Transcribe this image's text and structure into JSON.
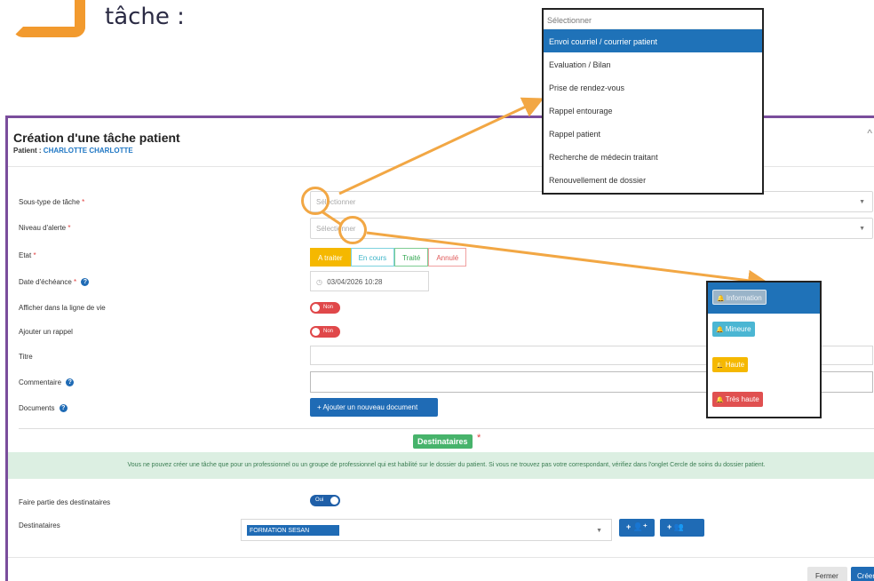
{
  "step": {
    "title": "tâche :"
  },
  "modal": {
    "title": "Création d'une tâche patient",
    "patient_label": "Patient :",
    "patient_name": "CHARLOTTE CHARLOTTE",
    "close_icon": "^"
  },
  "form": {
    "subtype_label": "Sous-type de tâche",
    "alert_label": "Niveau d'alerte",
    "state_label": "Etat",
    "due_label": "Date d'échéance",
    "timeline_label": "Afficher dans la ligne de vie",
    "reminder_label": "Ajouter un rappel",
    "title_label": "Titre",
    "comment_label": "Commentaire",
    "documents_label": "Documents",
    "required_mark": "*",
    "help_icon": "?",
    "select_placeholder": "Sélectionner",
    "states": [
      "A traiter",
      "En cours",
      "Traité",
      "Annulé"
    ],
    "due_date": "03/04/2026 10:28",
    "toggle_off": "Non",
    "toggle_on": "Oui",
    "add_document": "+ Ajouter un nouveau document"
  },
  "recipients": {
    "section_label": "Destinataires",
    "info_text": "Vous ne pouvez créer une tâche que pour un professionnel ou un groupe de professionnel qui est habilité sur le dossier du patient. Si vous ne trouvez pas votre correspondant, vérifiez dans l'onglet Cercle de soins du dossier patient.",
    "self_label": "Faire partie des destinataires",
    "list_label": "Destinataires",
    "selected": "FORMATION SESAN",
    "add_person": "+ 👤⁺",
    "add_group": "+ 👥"
  },
  "footer": {
    "close": "Fermer",
    "create": "Créer"
  },
  "subtype_dropdown": {
    "placeholder": "Sélectionner",
    "options": [
      "Envoi courriel / courrier patient",
      "Evaluation / Bilan",
      "Prise de rendez-vous",
      "Rappel entourage",
      "Rappel patient",
      "Recherche de médecin traitant",
      "Renouvellement de dossier"
    ],
    "selected_index": 0
  },
  "alert_dropdown": {
    "options": [
      "Information",
      "Mineure",
      "Haute",
      "Très haute"
    ],
    "selected_index": 0
  },
  "colors": {
    "accent_orange": "#f29a2e",
    "primary_blue": "#1f6bb5",
    "modal_border": "#7a4d9c",
    "success_green": "#47b36b"
  }
}
